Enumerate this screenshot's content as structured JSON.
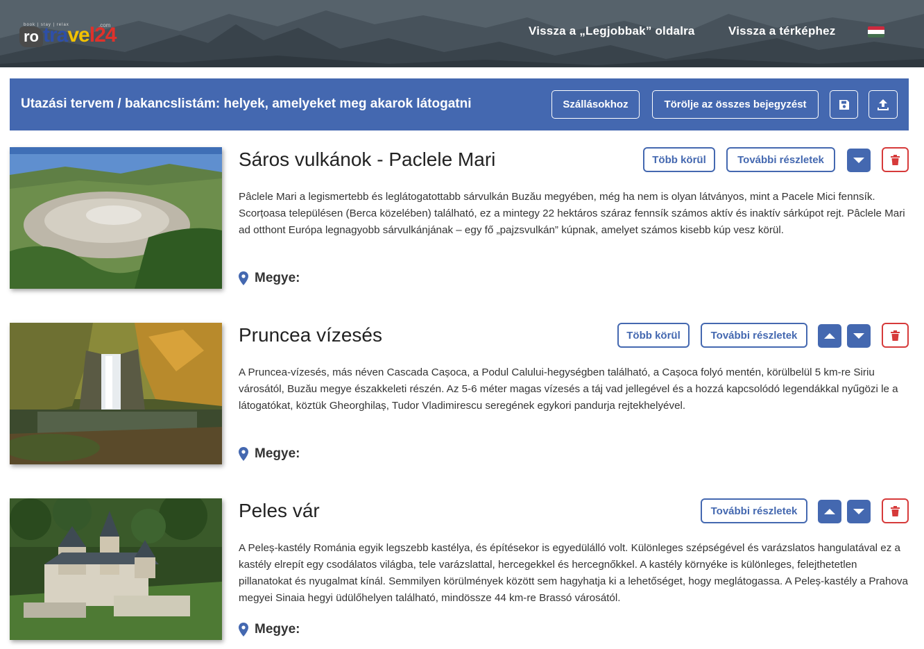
{
  "header": {
    "logo": {
      "ro": "ro",
      "travel_a": "tra",
      "travel_b": "ve",
      "travel_c": "l24",
      "tagline": "book | stay | relax",
      "domain": ".com"
    },
    "nav": [
      {
        "label": "Vissza a „Legjobbak” oldalra"
      },
      {
        "label": "Vissza a térképhez"
      }
    ],
    "language_flag": "hungarian-flag",
    "flag_colors": [
      "#cd2a3e",
      "#ffffff",
      "#436f4d"
    ]
  },
  "plan_bar": {
    "title": "Utazási tervem / bakancslistám: helyek, amelyeket meg akarok látogatni",
    "accommodation_button": "Szállásokhoz",
    "delete_all_button": "Törölje az összes bejegyzést",
    "save_icon": "save-icon",
    "upload_icon": "upload-icon"
  },
  "colors": {
    "primary": "#4468b0",
    "danger": "#d63a3a"
  },
  "items": [
    {
      "title": "Sáros vulkánok - Paclele Mari",
      "description": "Pâclele Mari a legismertebb és leglátogatottabb sárvulkán Buzău megyében, még ha nem is olyan látványos, mint a Pacele Mici fennsík. Scorțoasa településen (Berca közelében) található, ez a mintegy 22 hektáros száraz fennsík számos aktív és inaktív sárkúpot rejt. Pâclele Mari ad otthont Európa legnagyobb sárvulkánjának – egy fő „pajzsvulkán” kúpnak, amelyet számos kisebb kúp vesz körül.",
      "more_around": "Több körül",
      "more_details": "További részletek",
      "county_label": "Megye:"
    },
    {
      "title": "Pruncea vízesés",
      "description": "A Pruncea-vízesés, más néven Cascada Cașoca, a Podul Calului-hegységben található, a Cașoca folyó mentén, körülbelül 5 km-re Siriu városától, Buzău megye északkeleti részén. Az 5-6 méter magas vízesés a táj vad jellegével és a hozzá kapcsolódó legendákkal nyűgözi le a látogatókat, köztük Gheorghilaș, Tudor Vladimirescu seregének egykori pandurja rejtekhelyével.",
      "more_around": "Több körül",
      "more_details": "További részletek",
      "county_label": "Megye:"
    },
    {
      "title": "Peles vár",
      "description": "A Peleș-kastély Románia egyik legszebb kastélya, és építésekor is egyedülálló volt. Különleges szépségével és varázslatos hangulatával ez a kastély elrepít egy csodálatos világba, tele varázslattal, hercegekkel és hercegnőkkel. A kastély környéke is különleges, felejthetetlen pillanatokat és nyugalmat kínál. Semmilyen körülmények között sem hagyhatja ki a lehetőséget, hogy meglátogassa. A Peleș-kastély a Prahova megyei Sinaia hegyi üdülőhelyen található, mindössze 44 km-re Brassó városától.",
      "more_details": "További részletek",
      "county_label": "Megye:"
    }
  ]
}
